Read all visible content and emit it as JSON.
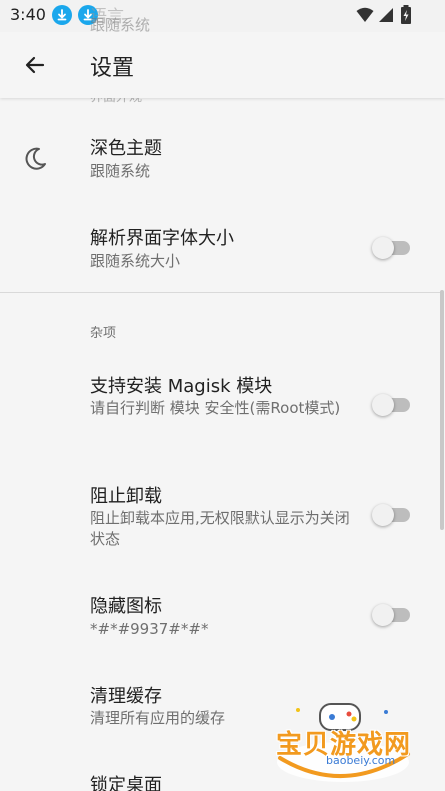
{
  "status_bar": {
    "time": "3:40",
    "icons": [
      "download-icon",
      "download-icon",
      "wifi-icon",
      "signal-icon",
      "battery-icon"
    ]
  },
  "ghost": {
    "title": "语言",
    "summary": "跟随系统",
    "section": "界面外观"
  },
  "toolbar": {
    "back_icon": "arrow-left-icon",
    "title": "设置"
  },
  "appearance": {
    "dark_theme": {
      "title": "深色主题",
      "summary": "跟随系统",
      "icon": "moon-icon"
    },
    "font_size": {
      "title": "解析界面字体大小",
      "summary": "跟随系统大小",
      "enabled": false
    }
  },
  "misc": {
    "header": "杂项",
    "items": [
      {
        "title": "支持安装 Magisk 模块",
        "summary": "请自行判断 模块 安全性(需Root模式)",
        "enabled": false
      },
      {
        "title": "阻止卸载",
        "summary": "阻止卸载本应用,无权限默认显示为关闭状态",
        "enabled": false
      },
      {
        "title": "隐藏图标",
        "summary": "*#*#9937#*#*",
        "enabled": false
      },
      {
        "title": "清理缓存",
        "summary": "清理所有应用的缓存"
      },
      {
        "title": "锁定桌面"
      }
    ]
  },
  "watermark": {
    "text": "宝贝游戏网",
    "url": "baobeiy.com"
  },
  "colors": {
    "background": "#f5f5f5",
    "accent_download": "#1aa7ec",
    "switch_track_off": "#bdbdbd",
    "watermark_brand": "#f29a1f"
  }
}
